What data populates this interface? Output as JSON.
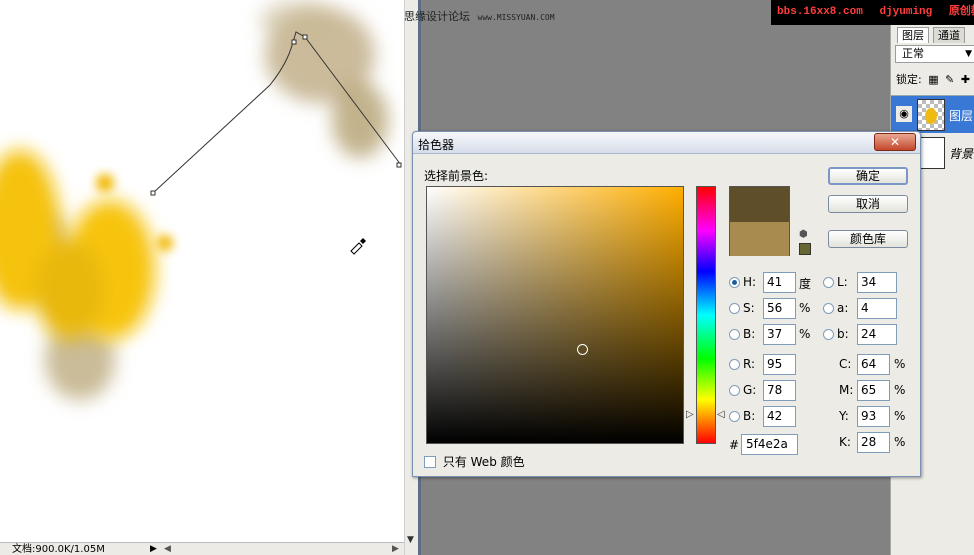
{
  "watermarks": {
    "forum": "思缘设计论坛",
    "url": "www.MISSYUAN.COM",
    "site": "bbs.16xx8.com",
    "author": "djyuming",
    "tag": "原创教程"
  },
  "status": {
    "doc_info": "文档:900.0K/1.05M"
  },
  "layers_panel": {
    "tabs": [
      "图层",
      "通道"
    ],
    "blend_mode": "正常",
    "lock_label": "锁定:",
    "layers": [
      {
        "name": "图层",
        "selected": true
      },
      {
        "name": "背景",
        "selected": false
      }
    ]
  },
  "color_picker": {
    "title": "拾色器",
    "prompt": "选择前景色:",
    "buttons": {
      "ok": "确定",
      "cancel": "取消",
      "library": "颜色库"
    },
    "fields": {
      "H": {
        "label": "H:",
        "value": "41",
        "unit": "度",
        "selected": true
      },
      "S": {
        "label": "S:",
        "value": "56",
        "unit": "%"
      },
      "B": {
        "label": "B:",
        "value": "37",
        "unit": "%"
      },
      "R": {
        "label": "R:",
        "value": "95"
      },
      "G": {
        "label": "G:",
        "value": "78"
      },
      "B2": {
        "label": "B:",
        "value": "42"
      },
      "L": {
        "label": "L:",
        "value": "34"
      },
      "a": {
        "label": "a:",
        "value": "4"
      },
      "b": {
        "label": "b:",
        "value": "24"
      },
      "C": {
        "label": "C:",
        "value": "64",
        "unit": "%"
      },
      "M": {
        "label": "M:",
        "value": "65",
        "unit": "%"
      },
      "Y": {
        "label": "Y:",
        "value": "93",
        "unit": "%"
      },
      "K": {
        "label": "K:",
        "value": "28",
        "unit": "%"
      }
    },
    "hex_label": "#",
    "hex": "5f4e2a",
    "web_only_label": "只有 Web 颜色",
    "colors": {
      "new": "#5f4e2a",
      "current": "#a88b4e",
      "web_safe": "#666633"
    }
  }
}
